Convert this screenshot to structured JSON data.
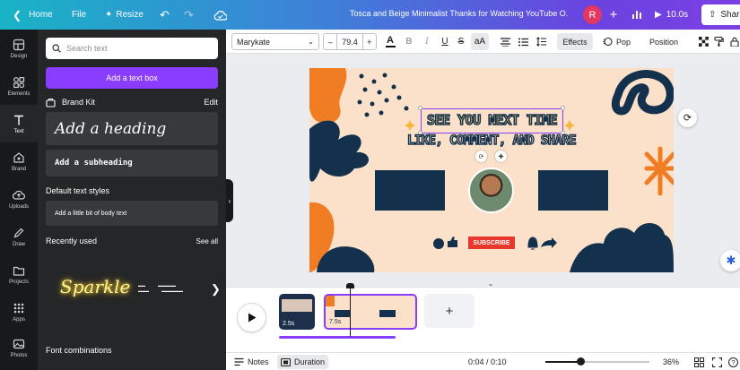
{
  "topbar": {
    "home_label": "Home",
    "file_label": "File",
    "resize_label": "Resize",
    "doc_title": "Tosca and Beige Minimalist Thanks for Watching YouTube O...",
    "avatar_initial": "R",
    "play_duration": "10.0s",
    "share_label": "Share"
  },
  "rail": {
    "items": [
      {
        "label": "Design",
        "icon": "design-icon"
      },
      {
        "label": "Elements",
        "icon": "elements-icon"
      },
      {
        "label": "Text",
        "icon": "text-icon"
      },
      {
        "label": "Brand",
        "icon": "brand-icon"
      },
      {
        "label": "Uploads",
        "icon": "uploads-icon"
      },
      {
        "label": "Draw",
        "icon": "draw-icon"
      },
      {
        "label": "Projects",
        "icon": "projects-icon"
      },
      {
        "label": "Apps",
        "icon": "apps-icon"
      },
      {
        "label": "Photos",
        "icon": "photos-icon"
      }
    ],
    "active": "Text"
  },
  "panel": {
    "search_placeholder": "Search text",
    "add_text_box": "Add a text box",
    "brand_kit": "Brand Kit",
    "brand_edit": "Edit",
    "add_heading": "Add a heading",
    "add_subheading": "Add a subheading",
    "default_styles": "Default text styles",
    "add_body": "Add a little bit of body text",
    "recently_used": "Recently used",
    "see_all": "See all",
    "recent_sparkle": "Sparkle",
    "font_combinations": "Font combinations"
  },
  "toolbar": {
    "font_name": "Marykate",
    "font_size": "79.4",
    "effects": "Effects",
    "pop": "Pop",
    "position": "Position"
  },
  "design": {
    "line1": "SEE YOU NEXT TIME",
    "line2": "LIKE, COMMENT, AND SHARE",
    "subscribe": "SUBSCRIBE",
    "colors": {
      "background": "#fbe1c9",
      "navy": "#13304d",
      "orange": "#f07d23",
      "selection": "#8b3dff"
    }
  },
  "timeline": {
    "clips": [
      {
        "duration": "2.5s"
      },
      {
        "duration": "7.5s"
      }
    ],
    "add_label": "+"
  },
  "bottombar": {
    "notes": "Notes",
    "duration": "Duration",
    "time": "0:04 / 0:10",
    "zoom": "36%",
    "zoom_fraction": 0.36
  }
}
